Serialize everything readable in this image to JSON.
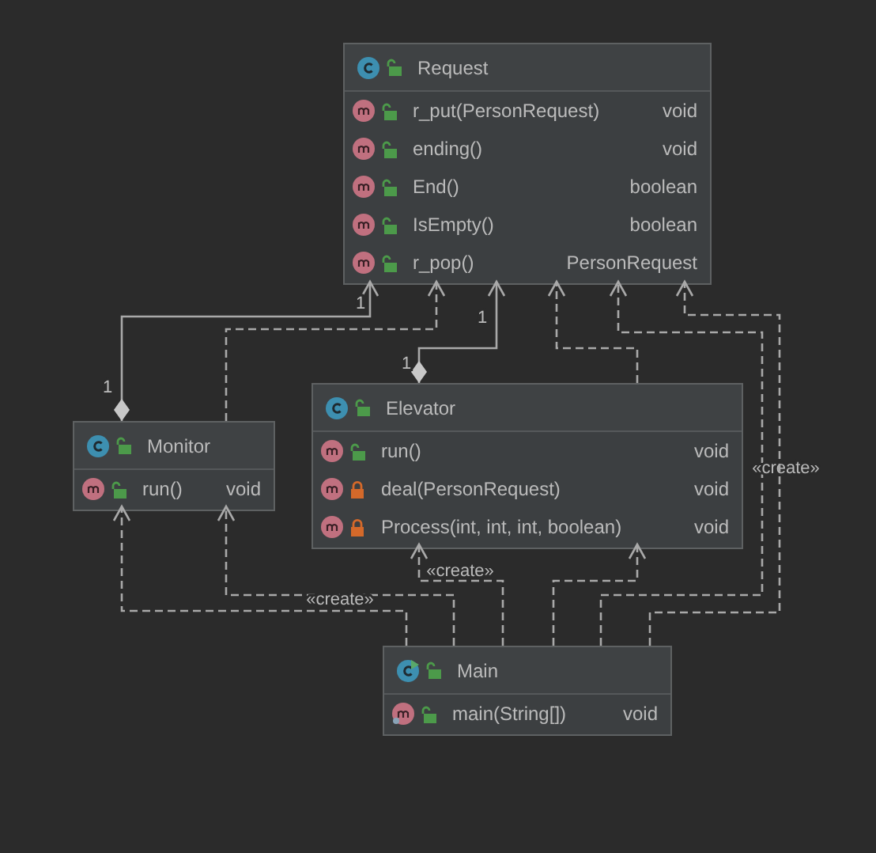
{
  "classes": [
    {
      "name": "Request",
      "kind": "class",
      "private": false,
      "methods": [
        {
          "name": "r_put(PersonRequest)",
          "type": "void",
          "private": false,
          "static": false
        },
        {
          "name": "ending()",
          "type": "void",
          "private": false,
          "static": false
        },
        {
          "name": "End()",
          "type": "boolean",
          "private": false,
          "static": false
        },
        {
          "name": "IsEmpty()",
          "type": "boolean",
          "private": false,
          "static": false
        },
        {
          "name": "r_pop()",
          "type": "PersonRequest",
          "private": false,
          "static": false
        }
      ]
    },
    {
      "name": "Monitor",
      "kind": "class",
      "private": false,
      "methods": [
        {
          "name": "run()",
          "type": "void",
          "private": false,
          "static": false
        }
      ]
    },
    {
      "name": "Elevator",
      "kind": "class",
      "private": false,
      "methods": [
        {
          "name": "run()",
          "type": "void",
          "private": false,
          "static": false
        },
        {
          "name": "deal(PersonRequest)",
          "type": "void",
          "private": true,
          "static": false
        },
        {
          "name": "Process(int, int, int, boolean)",
          "type": "void",
          "private": true,
          "static": false
        }
      ]
    },
    {
      "name": "Main",
      "kind": "main",
      "private": false,
      "methods": [
        {
          "name": "main(String[])",
          "type": "void",
          "private": false,
          "static": true
        }
      ]
    }
  ],
  "relations": [
    {
      "kind": "composition",
      "source_multiplicity": "1",
      "target_multiplicity": "1"
    },
    {
      "kind": "dependency"
    },
    {
      "kind": "composition",
      "source_multiplicity": "1",
      "target_multiplicity": "1"
    },
    {
      "kind": "dependency"
    },
    {
      "kind": "dependency",
      "label": "«create»"
    },
    {
      "kind": "dependency"
    },
    {
      "kind": "dependency"
    },
    {
      "kind": "dependency",
      "label": "«create»"
    },
    {
      "kind": "dependency",
      "label": "«create»"
    },
    {
      "kind": "dependency"
    }
  ]
}
